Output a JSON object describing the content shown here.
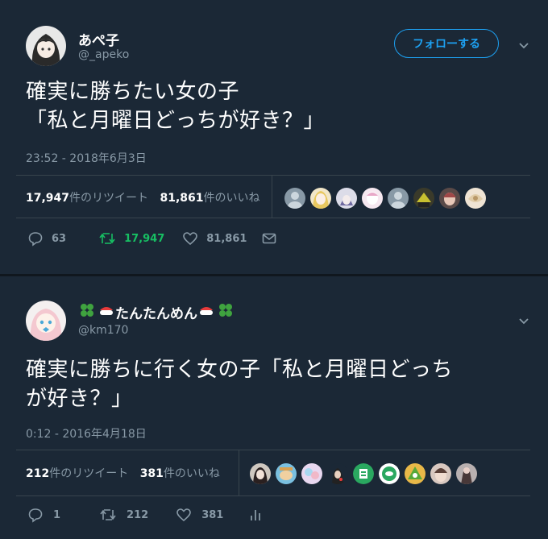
{
  "tweets": [
    {
      "name": "あぺ子",
      "handle": "@_apeko",
      "follow_label": "フォローする",
      "text": "確実に勝ちたい女の子\n「私と月曜日どっちが好き？」",
      "timestamp": "23:52 - 2018年6月3日",
      "retweets": "17,947",
      "retweets_label": "件のリツイート",
      "likes": "81,861",
      "likes_label": "件のいいね",
      "reply_count": "63",
      "retweet_count": "17,947",
      "like_count": "81,861"
    },
    {
      "name": "たんたんめん",
      "handle": "@km170",
      "text": "確実に勝ちに行く女の子「私と月曜日どっち\nが好き？」",
      "timestamp": "0:12 - 2016年4月18日",
      "retweets": "212",
      "retweets_label": "件のリツイート",
      "likes": "381",
      "likes_label": "件のいいね",
      "reply_count": "1",
      "retweet_count": "212",
      "like_count": "381"
    }
  ],
  "colors": {
    "background": "#1b2836",
    "accent": "#1da1f2",
    "muted": "#8899a6",
    "retweet_active": "#17bf63",
    "divider": "#38444d"
  },
  "icons": [
    "reply-icon",
    "retweet-icon",
    "like-icon",
    "dm-icon",
    "analytics-icon",
    "caret-down-icon",
    "clover-icon",
    "sushi-icon"
  ]
}
